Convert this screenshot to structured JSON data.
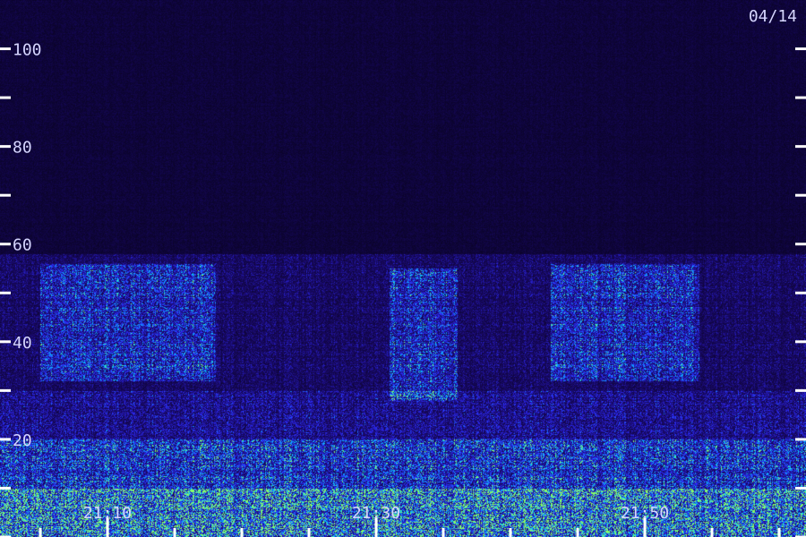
{
  "chart_data": {
    "type": "heatmap",
    "date_label": "04/14",
    "y_axis": {
      "range": [
        0,
        110
      ],
      "major_ticks": [
        20,
        40,
        60,
        80,
        100
      ],
      "major_tick_labels": [
        "20",
        "40",
        "60",
        "80",
        "100"
      ],
      "minor_ticks": [
        0,
        10,
        30,
        50,
        70,
        90
      ]
    },
    "x_axis": {
      "range": [
        "21:02",
        "21:62"
      ],
      "range_minutes": [
        0,
        60
      ],
      "major_ticks": [
        "21:10",
        "21:30",
        "21:50"
      ],
      "major_tick_labels": [
        "21:10",
        "21:30",
        "21:50"
      ],
      "minor_ticks_every_minutes": 5
    },
    "intensity_bands": [
      {
        "from": 0,
        "to": 10,
        "level": 0.95
      },
      {
        "from": 10,
        "to": 20,
        "level": 0.75
      },
      {
        "from": 20,
        "to": 30,
        "level": 0.55
      },
      {
        "from": 30,
        "to": 58,
        "level": 0.42
      },
      {
        "from": 58,
        "to": 110,
        "level": 0.18
      }
    ],
    "bright_bursts": [
      {
        "t_start": 3,
        "t_end": 16,
        "f_start": 32,
        "f_end": 56
      },
      {
        "t_start": 29,
        "t_end": 34,
        "f_start": 28,
        "f_end": 55
      },
      {
        "t_start": 41,
        "t_end": 52,
        "f_start": 32,
        "f_end": 56
      }
    ],
    "colors": {
      "background": "#000000",
      "low": "#1a0a6e",
      "mid": "#2d2dff",
      "high": "#00d2ff",
      "peak": "#88ff66",
      "axis": "#ffffff",
      "label": "#d6d6ff"
    }
  }
}
